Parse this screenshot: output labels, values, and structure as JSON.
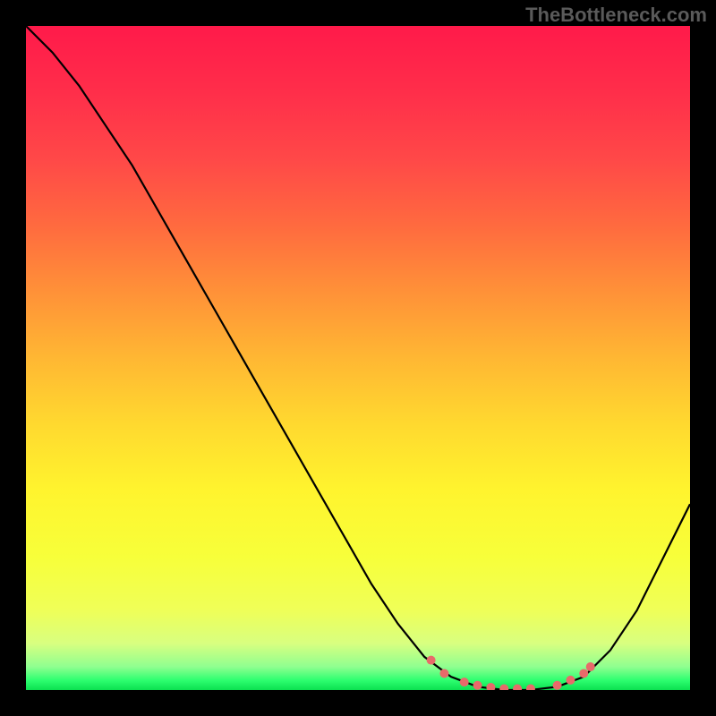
{
  "watermark": "TheBottleneck.com",
  "chart_data": {
    "type": "line",
    "title": "",
    "xlabel": "",
    "ylabel": "",
    "xlim": [
      0,
      100
    ],
    "ylim": [
      0,
      100
    ],
    "curve": [
      {
        "x": 0,
        "y": 100
      },
      {
        "x": 4,
        "y": 96
      },
      {
        "x": 8,
        "y": 91
      },
      {
        "x": 12,
        "y": 85
      },
      {
        "x": 16,
        "y": 79
      },
      {
        "x": 20,
        "y": 72
      },
      {
        "x": 24,
        "y": 65
      },
      {
        "x": 28,
        "y": 58
      },
      {
        "x": 32,
        "y": 51
      },
      {
        "x": 36,
        "y": 44
      },
      {
        "x": 40,
        "y": 37
      },
      {
        "x": 44,
        "y": 30
      },
      {
        "x": 48,
        "y": 23
      },
      {
        "x": 52,
        "y": 16
      },
      {
        "x": 56,
        "y": 10
      },
      {
        "x": 60,
        "y": 5
      },
      {
        "x": 64,
        "y": 2
      },
      {
        "x": 68,
        "y": 0.5
      },
      {
        "x": 72,
        "y": 0
      },
      {
        "x": 76,
        "y": 0
      },
      {
        "x": 80,
        "y": 0.5
      },
      {
        "x": 84,
        "y": 2
      },
      {
        "x": 88,
        "y": 6
      },
      {
        "x": 92,
        "y": 12
      },
      {
        "x": 96,
        "y": 20
      },
      {
        "x": 100,
        "y": 28
      }
    ],
    "markers": [
      {
        "x": 61,
        "y": 4.5
      },
      {
        "x": 63,
        "y": 2.5
      },
      {
        "x": 66,
        "y": 1.2
      },
      {
        "x": 68,
        "y": 0.7
      },
      {
        "x": 70,
        "y": 0.4
      },
      {
        "x": 72,
        "y": 0.2
      },
      {
        "x": 74,
        "y": 0.2
      },
      {
        "x": 76,
        "y": 0.2
      },
      {
        "x": 80,
        "y": 0.7
      },
      {
        "x": 82,
        "y": 1.5
      },
      {
        "x": 84,
        "y": 2.5
      },
      {
        "x": 85,
        "y": 3.5
      }
    ],
    "gradient_stops": [
      {
        "offset": 0.0,
        "color": "#ff1a4a"
      },
      {
        "offset": 0.1,
        "color": "#ff2e4a"
      },
      {
        "offset": 0.2,
        "color": "#ff4848"
      },
      {
        "offset": 0.3,
        "color": "#ff6a3f"
      },
      {
        "offset": 0.4,
        "color": "#ff9138"
      },
      {
        "offset": 0.5,
        "color": "#ffb733"
      },
      {
        "offset": 0.6,
        "color": "#ffd92f"
      },
      {
        "offset": 0.7,
        "color": "#fff42e"
      },
      {
        "offset": 0.8,
        "color": "#f7ff3a"
      },
      {
        "offset": 0.88,
        "color": "#efff58"
      },
      {
        "offset": 0.93,
        "color": "#d8ff80"
      },
      {
        "offset": 0.965,
        "color": "#8fff90"
      },
      {
        "offset": 0.985,
        "color": "#2eff70"
      },
      {
        "offset": 1.0,
        "color": "#0be050"
      }
    ],
    "marker_color": "#e86a6a",
    "curve_color": "#000000"
  }
}
